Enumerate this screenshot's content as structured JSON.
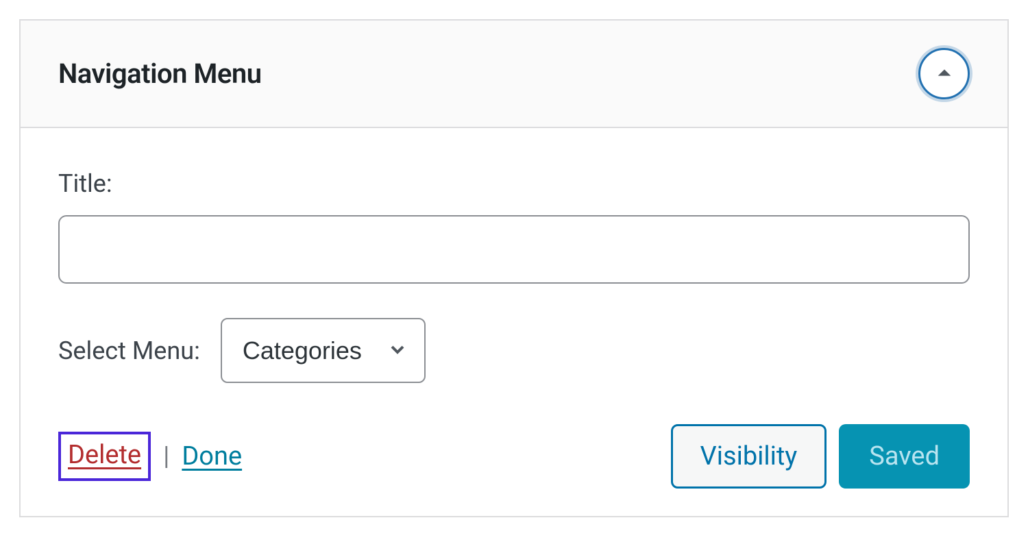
{
  "widget": {
    "title": "Navigation Menu"
  },
  "fields": {
    "title_label": "Title:",
    "title_value": "",
    "select_menu_label": "Select Menu:",
    "select_menu_value": "Categories"
  },
  "actions": {
    "delete": "Delete",
    "separator": "|",
    "done": "Done",
    "visibility": "Visibility",
    "saved": "Saved"
  },
  "colors": {
    "accent_blue": "#2271b1",
    "teal": "#007e9e",
    "danger": "#b32d2e",
    "highlight_border": "#4a26d9",
    "saved_bg": "#0693b2"
  }
}
